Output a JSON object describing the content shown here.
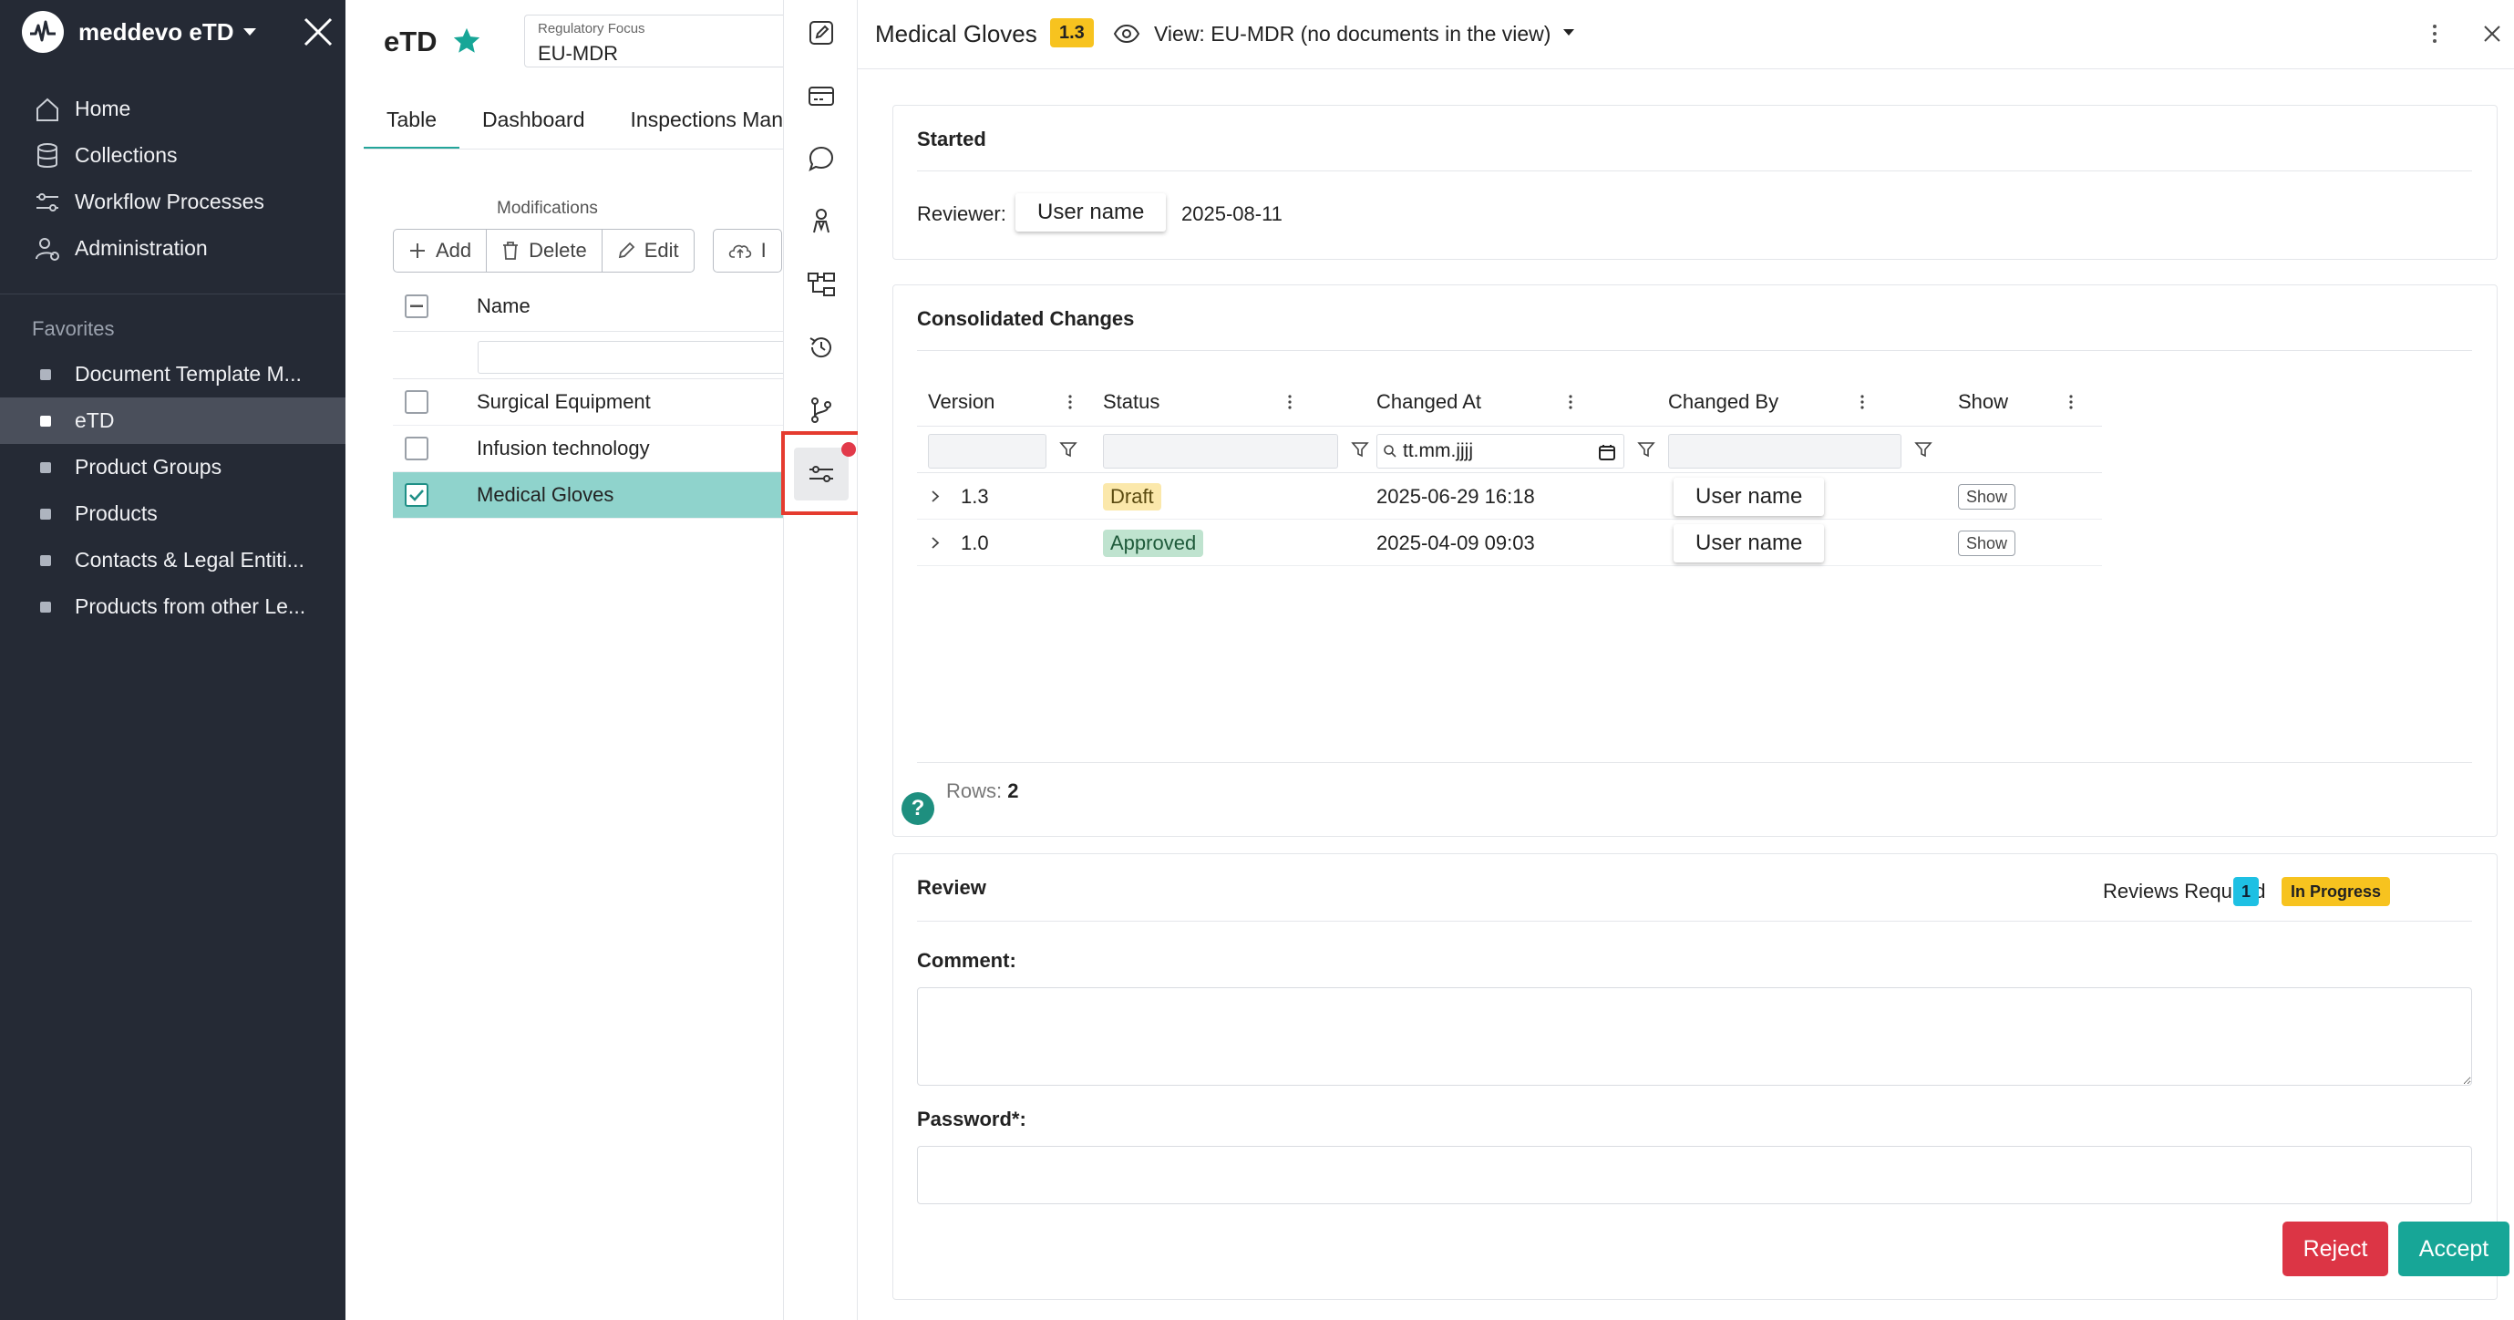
{
  "sidebar": {
    "brand": "meddevo eTD",
    "nav": [
      {
        "label": "Home",
        "icon": "home-icon"
      },
      {
        "label": "Collections",
        "icon": "database-icon"
      },
      {
        "label": "Workflow Processes",
        "icon": "workflow-icon"
      },
      {
        "label": "Administration",
        "icon": "admin-icon"
      }
    ],
    "favorites_heading": "Favorites",
    "favorites": [
      {
        "label": "Document Template M..."
      },
      {
        "label": "eTD",
        "active": true
      },
      {
        "label": "Product Groups"
      },
      {
        "label": "Products"
      },
      {
        "label": "Contacts & Legal Entiti..."
      },
      {
        "label": "Products from other Le..."
      }
    ]
  },
  "middle": {
    "title": "eTD",
    "focus_label": "Regulatory Focus",
    "focus_value": "EU-MDR",
    "tabs": [
      "Table",
      "Dashboard",
      "Inspections Man"
    ],
    "modifications_label": "Modifications",
    "buttons": {
      "add": "Add",
      "delete": "Delete",
      "edit": "Edit",
      "upload": "I"
    },
    "grid": {
      "column_name": "Name",
      "rows": [
        {
          "name": "Surgical Equipment",
          "checked": false
        },
        {
          "name": "Infusion technology",
          "checked": false
        },
        {
          "name": "Medical Gloves",
          "checked": true
        }
      ]
    }
  },
  "right": {
    "title": "Medical Gloves",
    "version_badge": "1.3",
    "view_label": "View: EU-MDR (no documents in the view)",
    "started": {
      "title": "Started",
      "reviewer_label": "Reviewer:",
      "reviewer_name": "User name",
      "date": "2025-08-11"
    },
    "changes": {
      "title": "Consolidated Changes",
      "columns": [
        "Version",
        "Status",
        "Changed At",
        "Changed By",
        "Show"
      ],
      "date_placeholder": "tt.mm.jjjj",
      "rows": [
        {
          "version": "1.3",
          "status": "Draft",
          "changed_at": "2025-06-29 16:18",
          "changed_by": "User name",
          "show": "Show"
        },
        {
          "version": "1.0",
          "status": "Approved",
          "changed_at": "2025-04-09 09:03",
          "changed_by": "User name",
          "show": "Show"
        }
      ],
      "rows_label": "Rows:",
      "rows_count": "2",
      "help": "?"
    },
    "review": {
      "title": "Review",
      "reviews_required_label": "Reviews Required",
      "reviews_required": "1",
      "status": "In Progress",
      "comment_label": "Comment:",
      "password_label": "Password*:",
      "reject": "Reject",
      "accept": "Accept"
    }
  },
  "colors": {
    "sidebar_bg": "#252a35",
    "accent": "#17a697",
    "reject": "#dc3545",
    "badge_yellow": "#f7c31f",
    "highlight": "#e53b2f"
  }
}
